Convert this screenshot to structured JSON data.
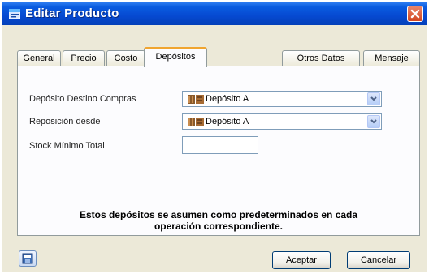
{
  "window": {
    "title": "Editar Producto"
  },
  "tabs": [
    {
      "label": "General"
    },
    {
      "label": "Precio"
    },
    {
      "label": "Costo"
    },
    {
      "label": "Depósitos"
    },
    {
      "label": "Otros Datos"
    },
    {
      "label": "Mensaje"
    }
  ],
  "active_tab": "Depósitos",
  "form": {
    "destino_label": "Depósito Destino Compras",
    "destino_value": "Depósito A",
    "reposicion_label": "Reposición desde",
    "reposicion_value": "Depósito A",
    "stock_label": "Stock Mínimo Total",
    "stock_value": ""
  },
  "note": {
    "line1": "Estos depósitos se asumen como predeterminados en cada",
    "line2": "operación correspondiente."
  },
  "buttons": {
    "accept": "Aceptar",
    "cancel": "Cancelar"
  },
  "colors": {
    "titlebar": "#0a5ce0",
    "active_tab_accent": "#f0a530",
    "window_bg": "#ece9d8"
  },
  "icons": {
    "title": "window-app-icon",
    "close": "close-icon",
    "combo_item": "depot-icon",
    "dropdown": "chevron-down-icon",
    "save": "save-icon"
  }
}
